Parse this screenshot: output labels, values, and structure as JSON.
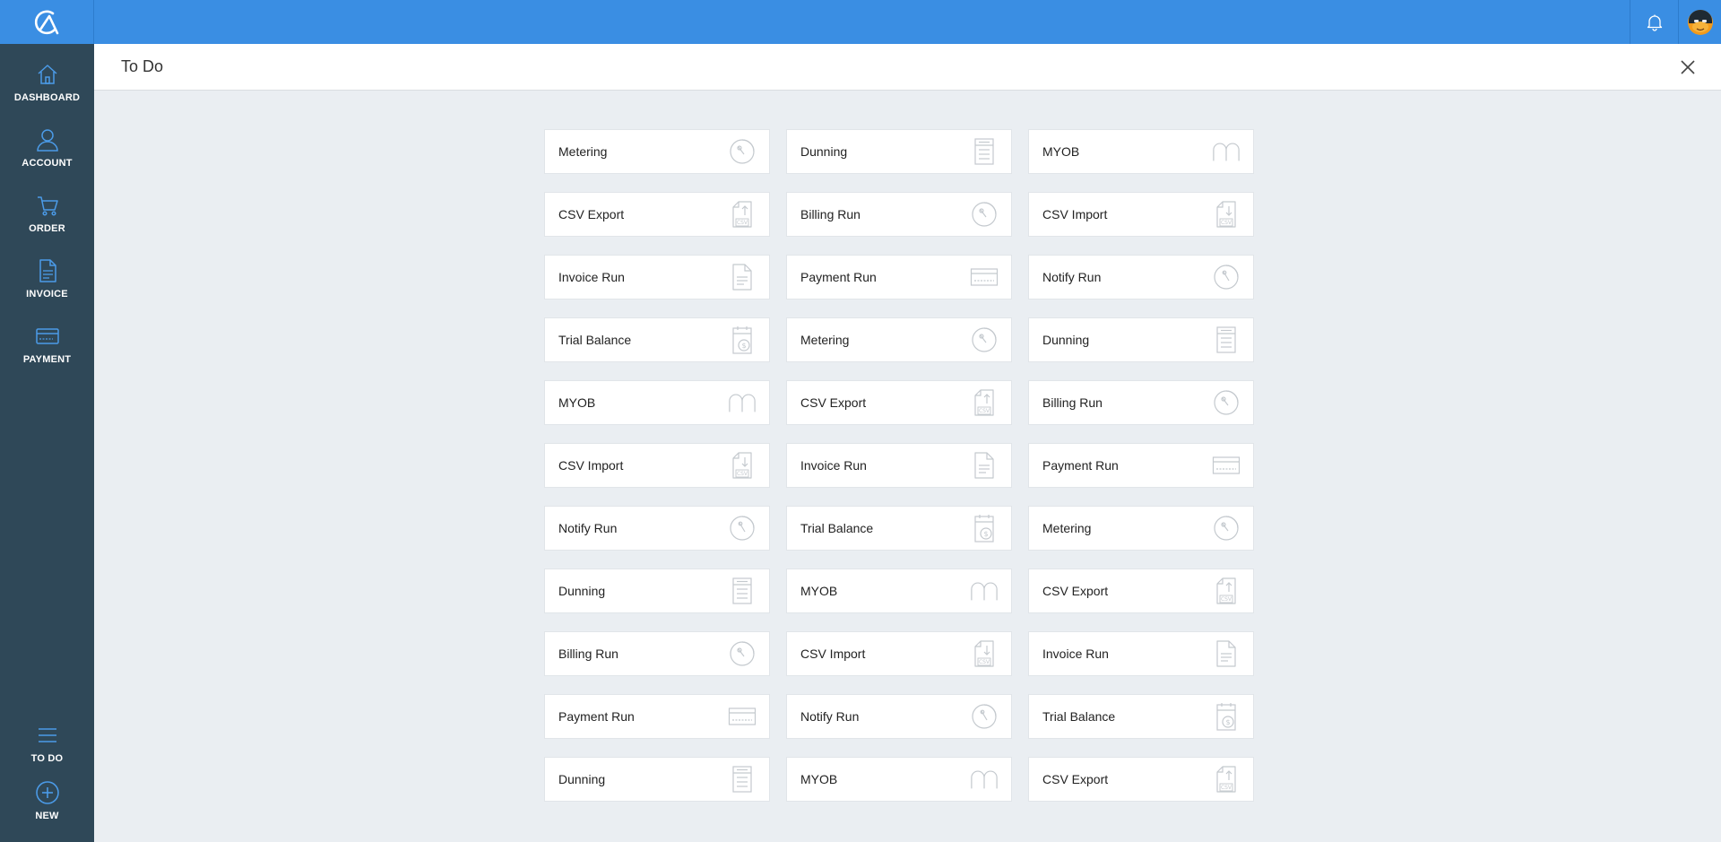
{
  "header": {
    "title": "To Do"
  },
  "nav": {
    "dashboard": "DASHBOARD",
    "account": "ACCOUNT",
    "order": "ORDER",
    "invoice": "INVOICE",
    "payment": "PAYMENT",
    "todo": "TO DO",
    "new": "NEW"
  },
  "colors": {
    "topbar": "#3a8ee3",
    "sidebar": "#2f4858",
    "background": "#eaeef2"
  },
  "tasks": [
    {
      "label": "Metering",
      "icon": "metering-icon"
    },
    {
      "label": "Dunning",
      "icon": "dunning-icon"
    },
    {
      "label": "MYOB",
      "icon": "myob-icon"
    },
    {
      "label": "CSV Export",
      "icon": "csv-export-icon"
    },
    {
      "label": "Billing Run",
      "icon": "billing-run-icon"
    },
    {
      "label": "CSV Import",
      "icon": "csv-import-icon"
    },
    {
      "label": "Invoice Run",
      "icon": "invoice-run-icon"
    },
    {
      "label": "Payment Run",
      "icon": "payment-run-icon"
    },
    {
      "label": "Notify Run",
      "icon": "notify-run-icon"
    },
    {
      "label": "Trial Balance",
      "icon": "trial-balance-icon"
    },
    {
      "label": "Metering",
      "icon": "metering-icon"
    },
    {
      "label": "Dunning",
      "icon": "dunning-icon"
    },
    {
      "label": "MYOB",
      "icon": "myob-icon"
    },
    {
      "label": "CSV Export",
      "icon": "csv-export-icon"
    },
    {
      "label": "Billing Run",
      "icon": "billing-run-icon"
    },
    {
      "label": "CSV Import",
      "icon": "csv-import-icon"
    },
    {
      "label": "Invoice Run",
      "icon": "invoice-run-icon"
    },
    {
      "label": "Payment Run",
      "icon": "payment-run-icon"
    },
    {
      "label": "Notify Run",
      "icon": "notify-run-icon"
    },
    {
      "label": "Trial Balance",
      "icon": "trial-balance-icon"
    },
    {
      "label": "Metering",
      "icon": "metering-icon"
    },
    {
      "label": "Dunning",
      "icon": "dunning-icon"
    },
    {
      "label": "MYOB",
      "icon": "myob-icon"
    },
    {
      "label": "CSV Export",
      "icon": "csv-export-icon"
    },
    {
      "label": "Billing Run",
      "icon": "billing-run-icon"
    },
    {
      "label": "CSV Import",
      "icon": "csv-import-icon"
    },
    {
      "label": "Invoice Run",
      "icon": "invoice-run-icon"
    },
    {
      "label": "Payment Run",
      "icon": "payment-run-icon"
    },
    {
      "label": "Notify Run",
      "icon": "notify-run-icon"
    },
    {
      "label": "Trial Balance",
      "icon": "trial-balance-icon"
    },
    {
      "label": "Dunning",
      "icon": "dunning-icon"
    },
    {
      "label": "MYOB",
      "icon": "myob-icon"
    },
    {
      "label": "CSV Export",
      "icon": "csv-export-icon"
    }
  ]
}
